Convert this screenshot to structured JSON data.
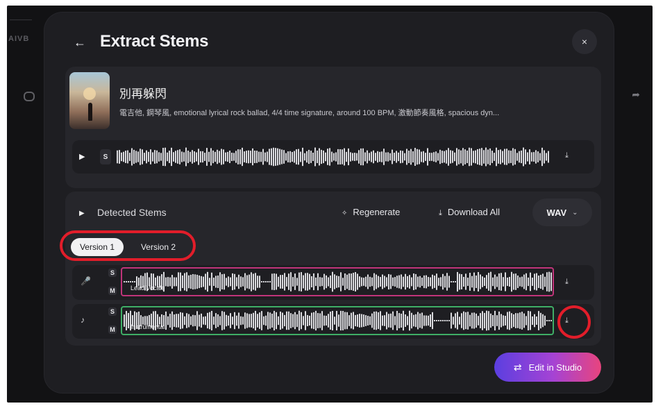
{
  "background": {
    "tiny_text": "————",
    "brand": "AIVB"
  },
  "modal": {
    "title": "Extract Stems",
    "back_icon": "←",
    "close_icon": "×"
  },
  "song": {
    "title": "別再躲閃",
    "description": "電吉他, 鋼琴風, emotional lyrical rock ballad, 4/4 time signature, around 100 BPM, 激動節奏風格, spacious dyn...",
    "play_icon": "▶",
    "solo_label": "S",
    "download_icon": "⤓"
  },
  "stems": {
    "section_label": "Detected Stems",
    "toggle_icon": "▶",
    "regenerate_icon": "✧",
    "regenerate_label": "Regenerate",
    "download_all_icon": "⤓",
    "download_all_label": "Download All",
    "format_value": "WAV",
    "format_chevron": "⌄",
    "versions": [
      "Version 1",
      "Version 2"
    ],
    "rows": [
      {
        "label": "Lead Vocals",
        "icon": "🎤",
        "solo": "S",
        "mute": "M",
        "border": "#c0347a"
      },
      {
        "label": "Instrumental",
        "icon": "♪",
        "solo": "S",
        "mute": "M",
        "border": "#3fae66"
      }
    ],
    "row_download_icon": "⤓"
  },
  "studio_button": {
    "label": "Edit in Studio",
    "icon": "⇄"
  },
  "colors": {
    "highlight": "#e21d2a",
    "vocals_border": "#c0347a",
    "instrumental_border": "#3fae66"
  }
}
